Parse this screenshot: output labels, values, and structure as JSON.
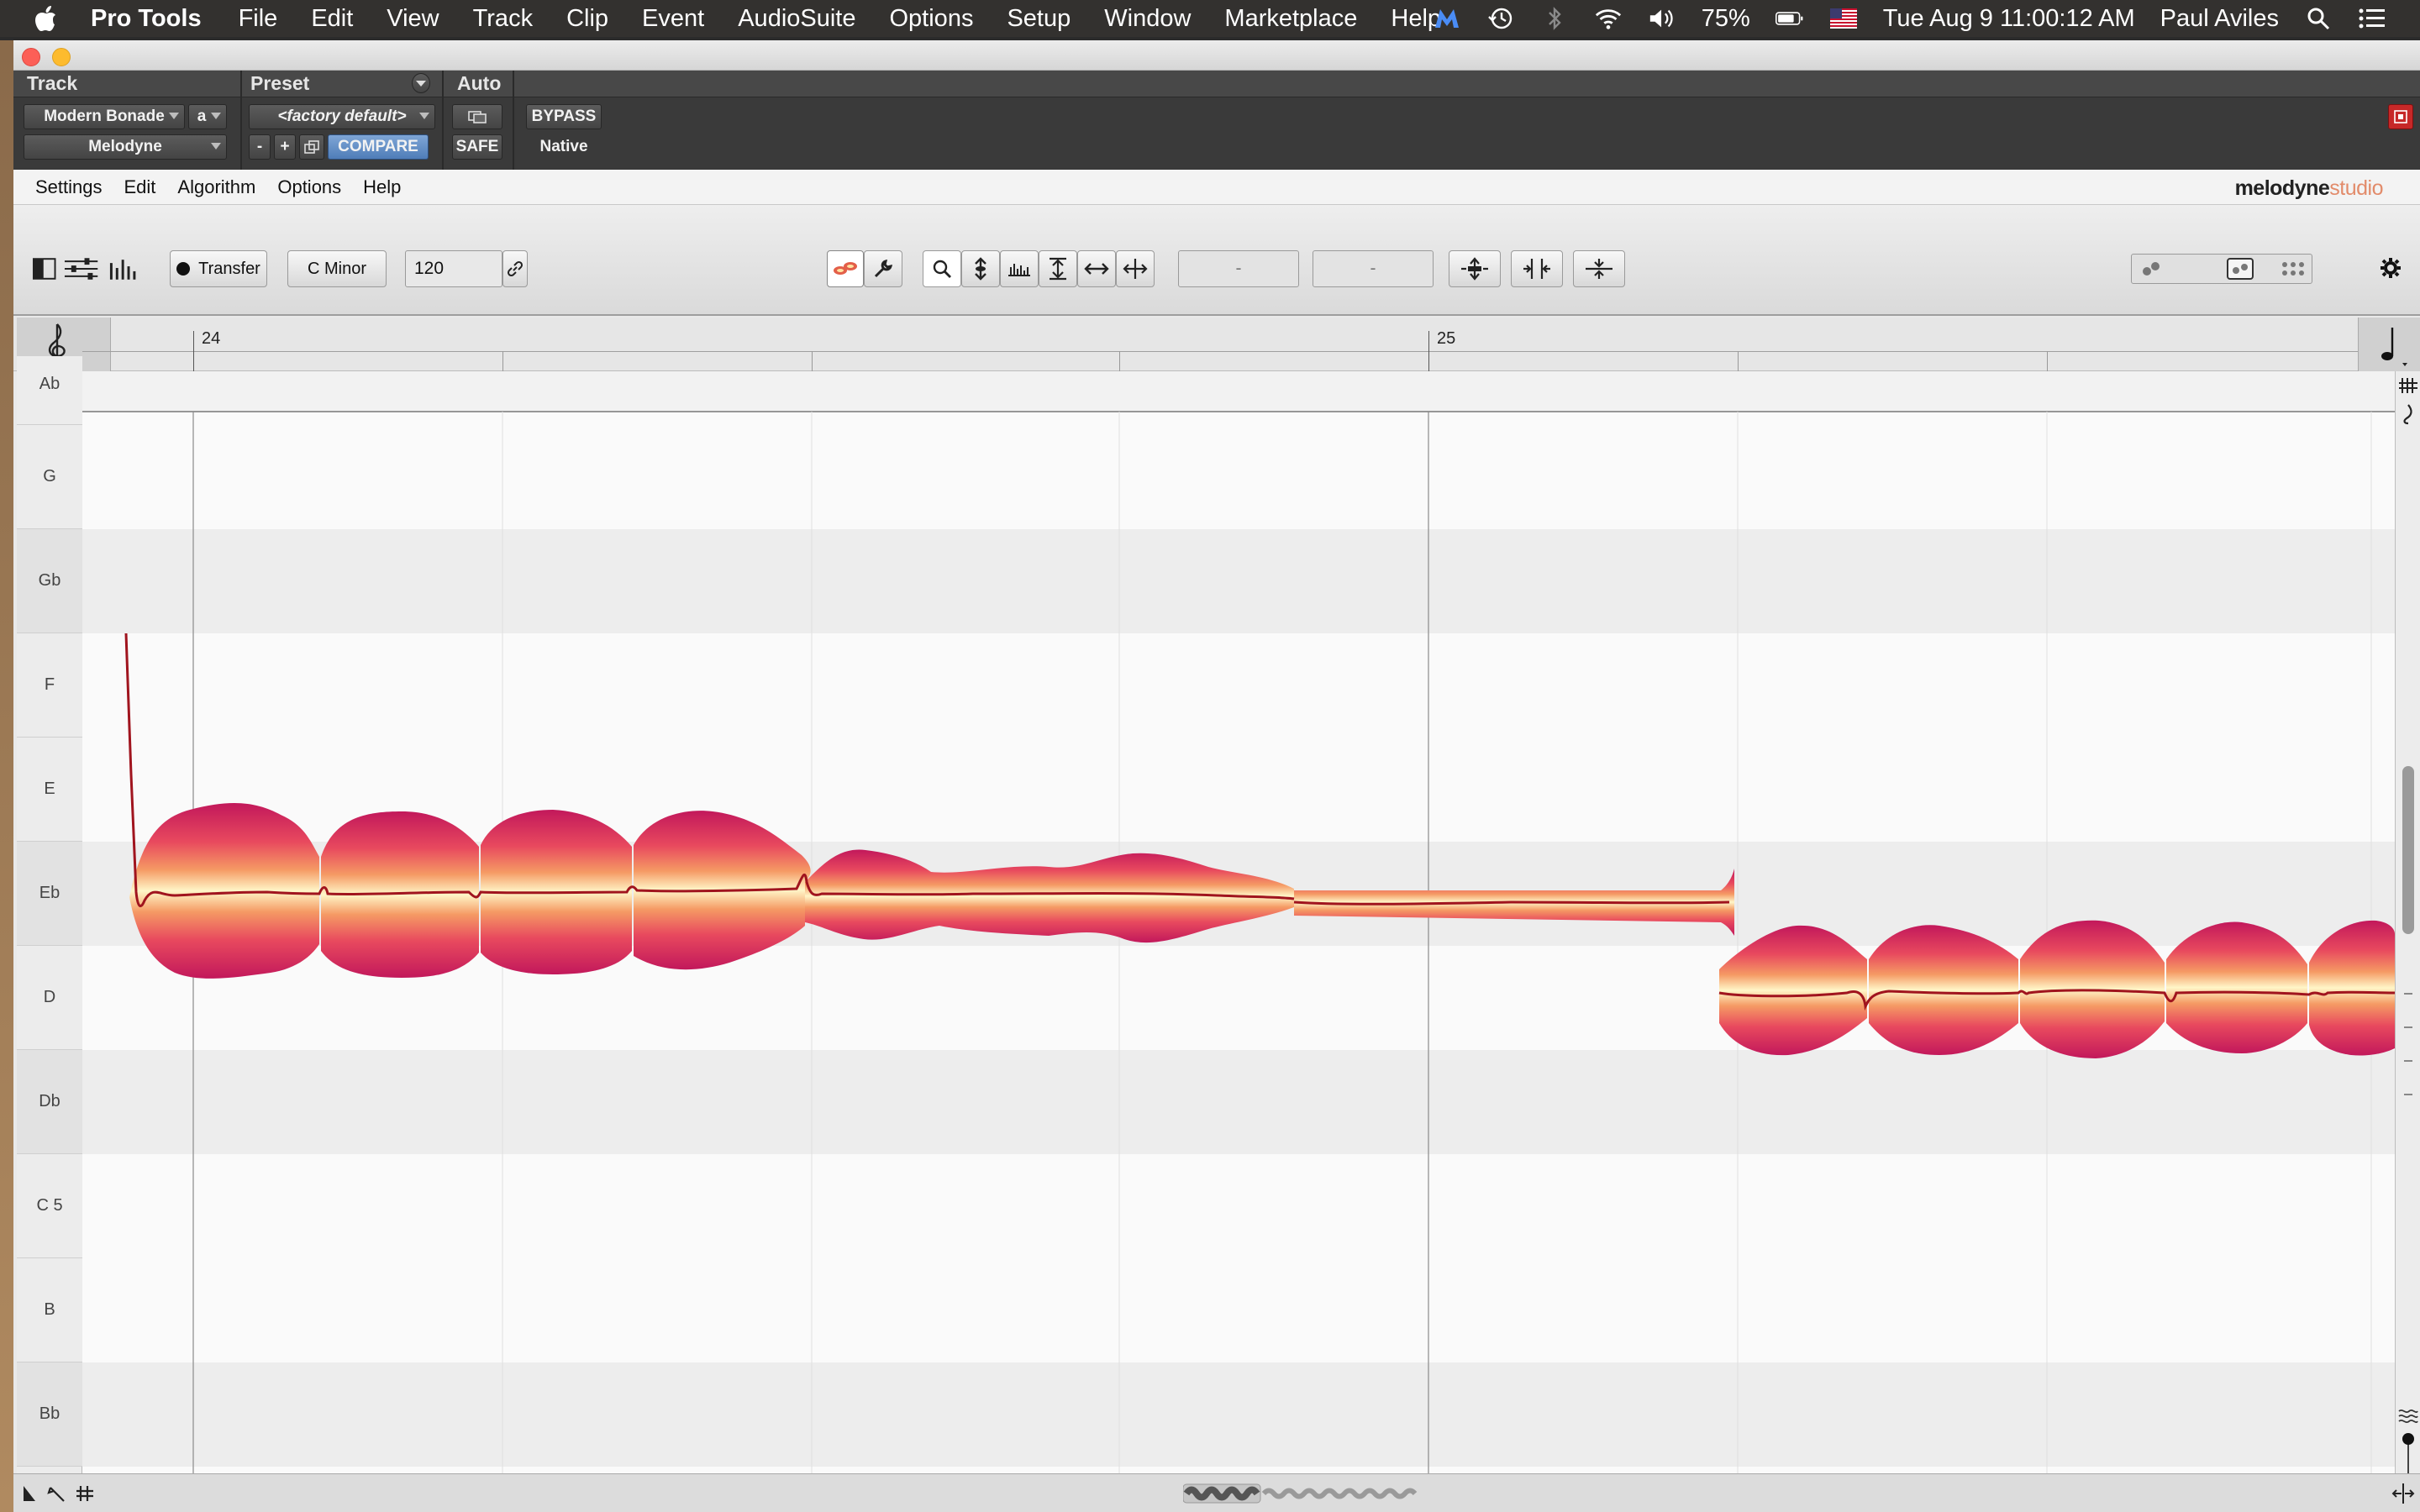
{
  "mac_menubar": {
    "app_name": "Pro Tools",
    "menus": [
      "File",
      "Edit",
      "View",
      "Track",
      "Clip",
      "Event",
      "AudioSuite",
      "Options",
      "Setup",
      "Window",
      "Marketplace",
      "Help"
    ],
    "battery": "75%",
    "datetime": "Tue Aug 9  11:00:12 AM",
    "user": "Paul Aviles"
  },
  "plugin_header": {
    "track_label": "Track",
    "preset_label": "Preset",
    "auto_label": "Auto",
    "track_name": "Modern Bonade",
    "track_channel": "a",
    "plugin_name": "Melodyne",
    "preset_name": "<factory default>",
    "minus": "-",
    "plus": "+",
    "compare": "COMPARE",
    "bypass": "BYPASS",
    "safe": "SAFE",
    "native": "Native"
  },
  "melodyne_menu": {
    "items": [
      "Settings",
      "Edit",
      "Algorithm",
      "Options",
      "Help"
    ],
    "logo_main": "melodyne",
    "logo_sub": "studio"
  },
  "toolbar": {
    "transfer": "Transfer",
    "key": "C Minor",
    "tempo": "120",
    "field1": "-",
    "field2": "-"
  },
  "ruler": {
    "bars": [
      "24",
      "25"
    ]
  },
  "keys": [
    "Ab",
    "G",
    "Gb",
    "F",
    "E",
    "Eb",
    "D",
    "Db",
    "C 5",
    "B",
    "Bb"
  ],
  "colors": {
    "blob_edge": "#c2185b",
    "blob_mid": "#f0764a",
    "blob_core": "#fff6c8",
    "pitch_line": "#a0141e",
    "compare_accent": "#5b86c0"
  }
}
